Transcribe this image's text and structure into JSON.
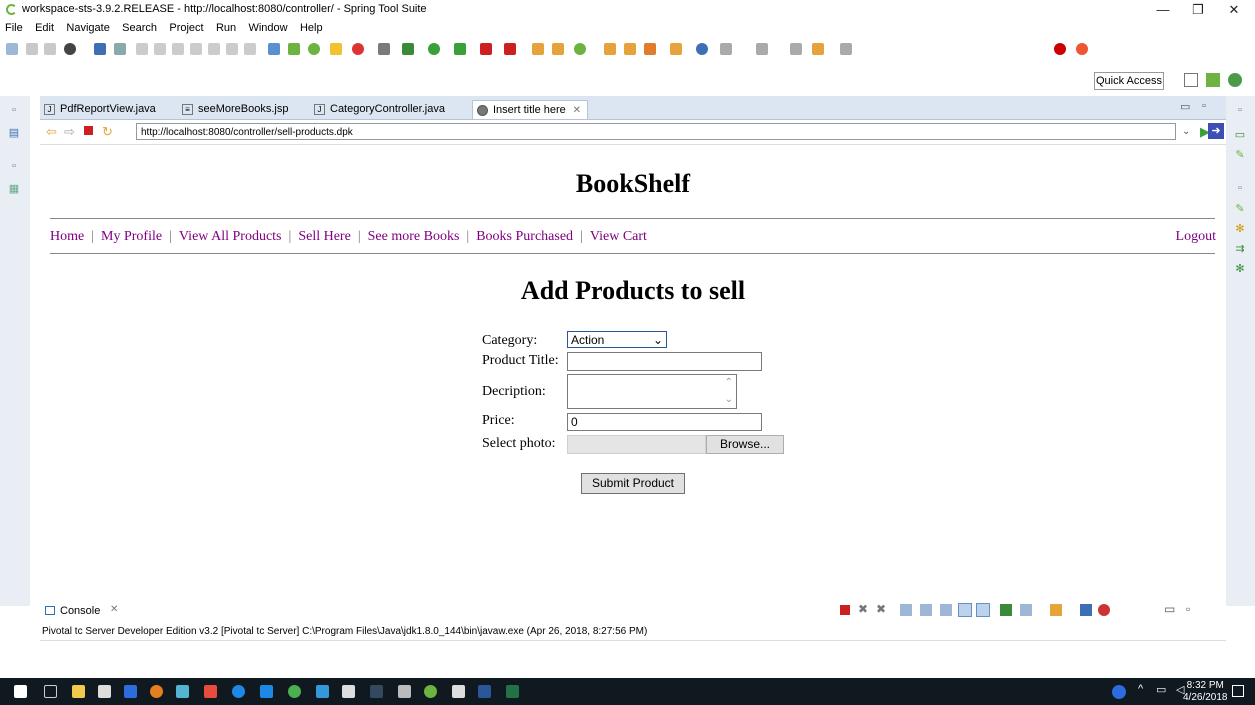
{
  "window": {
    "title": "workspace-sts-3.9.2.RELEASE - http://localhost:8080/controller/ - Spring Tool Suite",
    "min": "—",
    "max": "❐",
    "close": "✕"
  },
  "menubar": {
    "items": [
      "File",
      "Edit",
      "Navigate",
      "Search",
      "Project",
      "Run",
      "Window",
      "Help"
    ]
  },
  "quick_access": "Quick Access",
  "editor_tabs": [
    {
      "label": "PdfReportView.java",
      "icon": "java-file-icon"
    },
    {
      "label": "seeMoreBooks.jsp",
      "icon": "jsp-file-icon"
    },
    {
      "label": "CategoryController.java",
      "icon": "java-file-icon"
    },
    {
      "label": "Insert title here",
      "icon": "globe-icon",
      "close": "✕"
    }
  ],
  "browser": {
    "url": "http://localhost:8080/controller/sell-products.dpk"
  },
  "page": {
    "site_title": "BookShelf",
    "nav": [
      "Home",
      "My Profile",
      "View All Products",
      "Sell Here",
      "See more Books",
      "Books Purchased",
      "View Cart"
    ],
    "nav_sep": "|",
    "logout": "Logout",
    "heading": "Add Products to sell",
    "form": {
      "category_label": "Category:",
      "category_value": "Action",
      "title_label": "Product Title:",
      "title_value": "",
      "description_label": "Decription:",
      "price_label": "Price:",
      "price_value": "0",
      "photo_label": "Select photo:",
      "browse_label": "Browse...",
      "submit_label": "Submit Product"
    }
  },
  "console": {
    "tab_label": "Console",
    "line": "Pivotal tc Server Developer Edition v3.2 [Pivotal tc Server] C:\\Program Files\\Java\\jdk1.8.0_144\\bin\\javaw.exe (Apr 26, 2018, 8:27:56 PM)"
  },
  "taskbar": {
    "time": "8:32 PM",
    "date": "4/26/2018"
  },
  "colors": {
    "nav_link": "#800080",
    "tab_strip": "#dce6f2",
    "taskbar": "#101820",
    "spring_green": "#6db33f"
  }
}
